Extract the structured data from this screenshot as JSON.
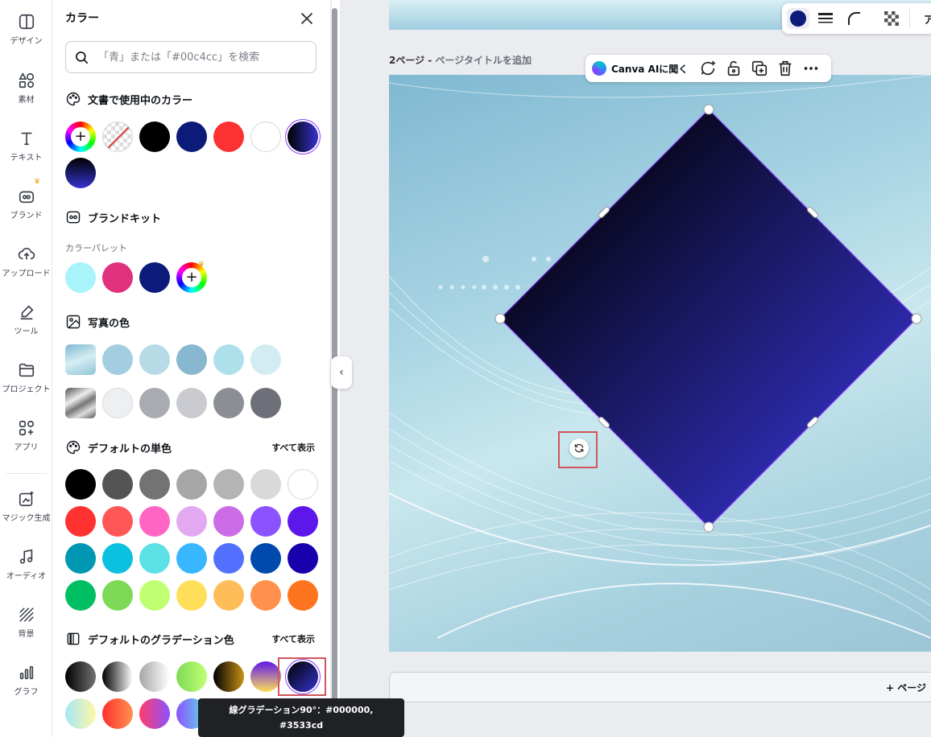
{
  "rail": {
    "items": [
      {
        "label": "デザイン",
        "icon": "design-icon"
      },
      {
        "label": "素材",
        "icon": "elements-icon"
      },
      {
        "label": "テキスト",
        "icon": "text-icon"
      },
      {
        "label": "ブランド",
        "icon": "brand-icon"
      },
      {
        "label": "アップロード",
        "icon": "upload-icon"
      },
      {
        "label": "ツール",
        "icon": "tools-icon"
      },
      {
        "label": "プロジェクト",
        "icon": "folder-icon"
      },
      {
        "label": "アプリ",
        "icon": "apps-icon"
      },
      {
        "label": "マジック生成",
        "icon": "magic-icon"
      },
      {
        "label": "オーディオ",
        "icon": "audio-icon"
      },
      {
        "label": "背景",
        "icon": "background-icon"
      },
      {
        "label": "グラフ",
        "icon": "chart-icon"
      }
    ]
  },
  "panel": {
    "title": "カラー",
    "search_placeholder": "「青」または「#00c4cc」を検索",
    "doc_colors": {
      "title": "文書で使用中のカラー",
      "swatches": [
        "rainbow-add",
        "transparent",
        "#000000",
        "#0c1a7a",
        "#fd3131",
        "#ffffff",
        "gradient:#000000-#3533cd",
        "gradient:#000000-#3533cd"
      ]
    },
    "brand_kit": {
      "title": "ブランドキット",
      "palette_label": "カラーパレット",
      "swatches": [
        "#a8f4fa",
        "#e0317d",
        "#0c1a7a",
        "rainbow-add"
      ]
    },
    "photo_colors": {
      "title": "写真の色",
      "row1": [
        "photo",
        "#a3cde0",
        "#b6dbe7",
        "#87b8d0",
        "#aee0ec",
        "#d2ecf1"
      ],
      "row2": [
        "photo",
        "#eeeff1",
        "#a8abb0",
        "#c9cbd0",
        "#8b8e95",
        "#6d7078"
      ]
    },
    "default_solid": {
      "title": "デフォルトの単色",
      "show_all": "すべて表示",
      "rows": [
        [
          "#000000",
          "#545454",
          "#737373",
          "#a6a6a6",
          "#b4b4b4",
          "#d9d9d9",
          "#ffffff"
        ],
        [
          "#ff3131",
          "#ff5757",
          "#ff66c4",
          "#e2a9f1",
          "#cb6ce6",
          "#8c52ff",
          "#5e17eb"
        ],
        [
          "#0097b2",
          "#0cc0df",
          "#5ce1e6",
          "#38b6ff",
          "#5271ff",
          "#004aad",
          "#1800ad"
        ],
        [
          "#00bf63",
          "#7ed957",
          "#c1ff72",
          "#ffde59",
          "#ffbd59",
          "#ff914d",
          "#ff751f"
        ]
      ]
    },
    "default_gradient": {
      "title": "デフォルトのグラデーション色",
      "show_all": "すべて表示",
      "row1": [
        "linear-gradient(90deg,#000,#737373)",
        "linear-gradient(90deg,#000,#fff)",
        "linear-gradient(90deg,#a6a6a6,#fff)",
        "linear-gradient(90deg,#7ed957,#c1ff72)",
        "linear-gradient(90deg,#000,#c89116)",
        "linear-gradient(180deg,#5e17eb,#ffde59)",
        "linear-gradient(135deg,#000,#3533cd)"
      ],
      "row2": [
        "linear-gradient(90deg,#a6e6f7,#fff8a5)",
        "linear-gradient(90deg,#ff3131,#ff914d)",
        "linear-gradient(90deg,#ff3c68,#8c52ff)",
        "linear-gradient(90deg,#8c52ff,#5ce1e6)"
      ]
    }
  },
  "canvas": {
    "page_number": "2ページ - ",
    "page_title_placeholder": "ページタイトルを追加",
    "ai_button": "Canva AIに聞く",
    "add_page": "+ ページ",
    "top_toolbar_partial": "ア"
  },
  "tooltip": {
    "line1": "線グラデーション90°：#000000,",
    "line2": "#3533cd"
  },
  "colors": {
    "accent": "#8b3dff",
    "highlight": "#d0565c",
    "shape_start": "#000000",
    "shape_end": "#3533cd"
  }
}
